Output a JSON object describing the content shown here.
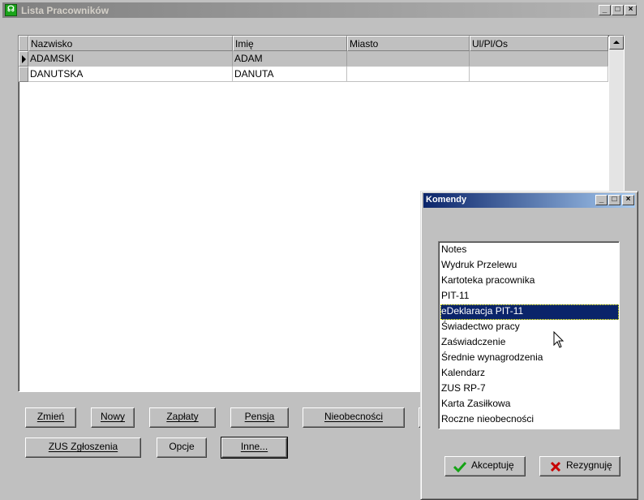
{
  "main_window": {
    "title": "Lista Pracowników",
    "grid": {
      "columns": [
        "Nazwisko",
        "Imię",
        "Miasto",
        "Ul/Pl/Os"
      ],
      "rows": [
        {
          "nazwisko": "ADAMSKI",
          "imie": "ADAM",
          "miasto": "",
          "ulica": "",
          "selected": true
        },
        {
          "nazwisko": "DANUTSKA",
          "imie": "DANUTA",
          "miasto": "",
          "ulica": "",
          "selected": false
        }
      ]
    },
    "buttons": {
      "zmien": "Zmień",
      "nowy": "Nowy",
      "zaplaty": "Zapłaty",
      "pensja": "Pensja",
      "nieobecnosci": "Nieobecności",
      "zus": "ZUS Zgłoszenia",
      "opcje": "Opcje",
      "inne": "Inne..."
    }
  },
  "komendy_dialog": {
    "title": "Komendy",
    "items": [
      "Notes",
      "Wydruk Przelewu",
      "Kartoteka pracownika",
      "PIT-11",
      "eDeklaracja PIT-11",
      "Świadectwo pracy",
      "Zaświadczenie",
      "Średnie wynagrodzenia",
      "Kalendarz",
      "ZUS RP-7",
      "Karta Zasiłkowa",
      "Roczne nieobecności"
    ],
    "selected_index": 4,
    "accept_label": "Akceptuję",
    "cancel_label": "Rezygnuję"
  },
  "colors": {
    "window_bg": "#c0c0c0",
    "active_title": "#0a246a",
    "inactive_title": "#808080",
    "selection": "#0a246a"
  }
}
